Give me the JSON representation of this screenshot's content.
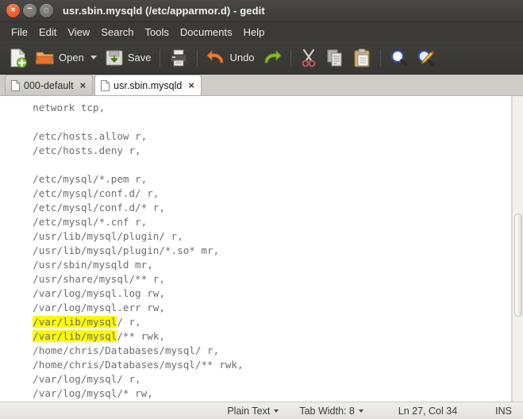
{
  "window": {
    "title": "usr.sbin.mysqld (/etc/apparmor.d) - gedit",
    "controls": {
      "close": "×",
      "minimize": "−",
      "maximize": "□"
    }
  },
  "menubar": {
    "items": [
      "File",
      "Edit",
      "View",
      "Search",
      "Tools",
      "Documents",
      "Help"
    ]
  },
  "toolbar": {
    "new_label": "",
    "open_label": "Open",
    "save_label": "Save",
    "print_label": "",
    "undo_label": "Undo",
    "redo_label": "",
    "cut_label": "",
    "copy_label": "",
    "paste_label": "",
    "find_label": "",
    "replace_label": ""
  },
  "tabs": [
    {
      "name": "000-default",
      "close": "×",
      "active": false
    },
    {
      "name": "usr.sbin.mysqld",
      "close": "×",
      "active": true
    }
  ],
  "editor": {
    "lines": [
      [
        {
          "t": "  network tcp,"
        }
      ],
      [
        {
          "t": ""
        }
      ],
      [
        {
          "t": "  /etc/hosts.allow r,"
        }
      ],
      [
        {
          "t": "  /etc/hosts.deny r,"
        }
      ],
      [
        {
          "t": ""
        }
      ],
      [
        {
          "t": "  /etc/mysql/*.pem r,"
        }
      ],
      [
        {
          "t": "  /etc/mysql/conf.d/ r,"
        }
      ],
      [
        {
          "t": "  /etc/mysql/conf.d/* r,"
        }
      ],
      [
        {
          "t": "  /etc/mysql/*.cnf r,"
        }
      ],
      [
        {
          "t": "  /usr/lib/mysql/plugin/ r,"
        }
      ],
      [
        {
          "t": "  /usr/lib/mysql/plugin/*.so* mr,"
        }
      ],
      [
        {
          "t": "  /usr/sbin/mysqld mr,"
        }
      ],
      [
        {
          "t": "  /usr/share/mysql/** r,"
        }
      ],
      [
        {
          "t": "  /var/log/mysql.log rw,"
        }
      ],
      [
        {
          "t": "  /var/log/mysql.err rw,"
        }
      ],
      [
        {
          "t": "  "
        },
        {
          "t": "/var/lib/mysql",
          "hl": true
        },
        {
          "t": "/ r,"
        }
      ],
      [
        {
          "t": "  "
        },
        {
          "t": "/var/lib/mysql",
          "hl": true
        },
        {
          "t": "/** rwk,"
        }
      ],
      [
        {
          "t": "  /home/chris/Databases/mysql/ r,"
        }
      ],
      [
        {
          "t": "  /home/chris/Databases/mysql/** rwk,"
        }
      ],
      [
        {
          "t": "  /var/log/mysql/ r,"
        }
      ],
      [
        {
          "t": "  /var/log/mysql/* rw,"
        }
      ]
    ],
    "highlight_color": "#fbf90a",
    "text_color": "#6e6e6e"
  },
  "statusbar": {
    "language": "Plain Text",
    "tab_width": "Tab Width: 8",
    "position": "Ln 27, Col 34",
    "insert_mode": "INS"
  }
}
